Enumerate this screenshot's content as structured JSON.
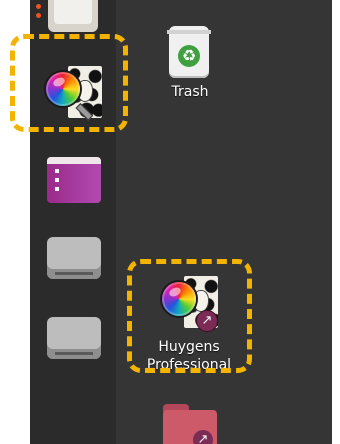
{
  "desktop": {
    "icons": [
      {
        "label": "Trash",
        "icon": "trash-icon"
      },
      {
        "label_line1": "Huygens",
        "label_line2": "Professional",
        "icon": "huygens-professional-icon"
      },
      {
        "label": "",
        "icon": "folder-shortcut-icon"
      }
    ]
  },
  "dock": {
    "items": [
      {
        "icon": "files-icon"
      },
      {
        "icon": "huygens-professional-icon"
      },
      {
        "icon": "app-window-icon"
      },
      {
        "icon": "drive-icon"
      },
      {
        "icon": "drive-icon"
      }
    ]
  },
  "colors": {
    "highlight": "#f2b400",
    "dock_bg": "#2b2b2b",
    "desktop_bg": "#353535"
  }
}
